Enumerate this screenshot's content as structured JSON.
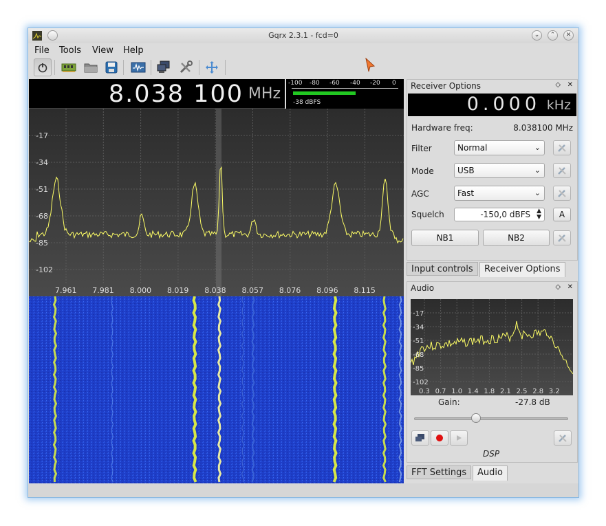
{
  "window": {
    "title": "Gqrx 2.3.1 - fcd=0",
    "controls": {
      "minimize": "⌄",
      "maximize": "⌃",
      "close": "✕"
    }
  },
  "menu": [
    "File",
    "Tools",
    "View",
    "Help"
  ],
  "toolbar": {
    "icons": [
      "power-icon",
      "hardware-card-icon",
      "folder-icon",
      "save-icon",
      "waveform-icon",
      "network-icon",
      "tools-icon",
      "fullscreen-icon"
    ]
  },
  "frequency": {
    "value": "8.038 100",
    "unit": "MHz"
  },
  "smeter": {
    "ticks": [
      "-100",
      "-80",
      "-60",
      "-40",
      "-20",
      "0"
    ],
    "level_label": "-38 dBFS",
    "level_dbfs": -38
  },
  "spectrum": {
    "y_ticks": [
      "-17",
      "-34",
      "-51",
      "-68",
      "-85",
      "-102"
    ],
    "x_ticks": [
      "7.961",
      "7.981",
      "8.000",
      "8.019",
      "8.038",
      "8.057",
      "8.076",
      "8.096",
      "8.115"
    ]
  },
  "receiver_options": {
    "title": "Receiver Options",
    "offset": {
      "value": "0.000",
      "unit": "kHz"
    },
    "hardware_freq_label": "Hardware freq:",
    "hardware_freq_value": "8.038100 MHz",
    "filter_label": "Filter",
    "filter_value": "Normal",
    "mode_label": "Mode",
    "mode_value": "USB",
    "agc_label": "AGC",
    "agc_value": "Fast",
    "squelch_label": "Squelch",
    "squelch_value": "-150,0 dBFS",
    "squelch_auto": "A",
    "nb1": "NB1",
    "nb2": "NB2"
  },
  "tabs_top": [
    "Input controls",
    "Receiver Options"
  ],
  "audio": {
    "title": "Audio",
    "y_ticks": [
      "-17",
      "-34",
      "-51",
      "-68",
      "-85",
      "-102"
    ],
    "x_ticks": [
      "0.3",
      "0.7",
      "1.0",
      "1.4",
      "1.8",
      "2.1",
      "2.5",
      "2.8",
      "3.2"
    ],
    "gain_label": "Gain:",
    "gain_value": "-27.8 dB",
    "gain_slider_fraction": 0.4,
    "dsp_label": "DSP"
  },
  "tabs_bottom": [
    "FFT Settings",
    "Audio"
  ],
  "colors": {
    "trace": "#ffff66",
    "waterfall_bg": "#1e3ec8",
    "signal": "#e0f040",
    "meter_bar": "#22c822"
  }
}
